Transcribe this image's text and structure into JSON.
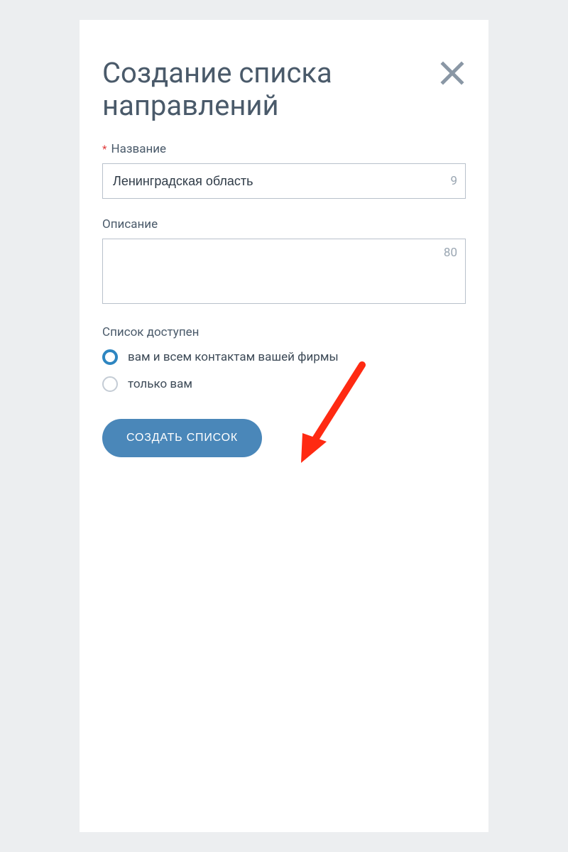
{
  "modal": {
    "title": "Создание списка направлений"
  },
  "fields": {
    "name": {
      "label": "Название",
      "required_indicator": "*",
      "value": "Ленинградская область",
      "counter": "9"
    },
    "description": {
      "label": "Описание",
      "value": "",
      "counter": "80"
    }
  },
  "visibility": {
    "label": "Список доступен",
    "options": [
      {
        "label": "вам и всем контактам вашей фирмы",
        "selected": true
      },
      {
        "label": "только вам",
        "selected": false
      }
    ]
  },
  "actions": {
    "submit": "СОЗДАТЬ СПИСОК"
  }
}
